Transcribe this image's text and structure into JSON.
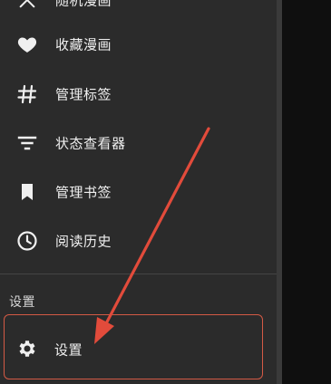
{
  "drawer": {
    "items": [
      {
        "label": "随机漫画",
        "icon": "shuffle-icon"
      },
      {
        "label": "收藏漫画",
        "icon": "heart-icon"
      },
      {
        "label": "管理标签",
        "icon": "hashtag-icon"
      },
      {
        "label": "状态查看器",
        "icon": "filter-list-icon"
      },
      {
        "label": "管理书签",
        "icon": "bookmark-icon"
      },
      {
        "label": "阅读历史",
        "icon": "clock-icon"
      }
    ],
    "section_title": "设置",
    "settings_item": {
      "label": "设置",
      "icon": "gear-icon"
    }
  },
  "colors": {
    "drawer_bg": "#2b2b2b",
    "text": "#f0f0f0",
    "highlight_border": "#d45a45",
    "arrow": "#e24b3b"
  }
}
